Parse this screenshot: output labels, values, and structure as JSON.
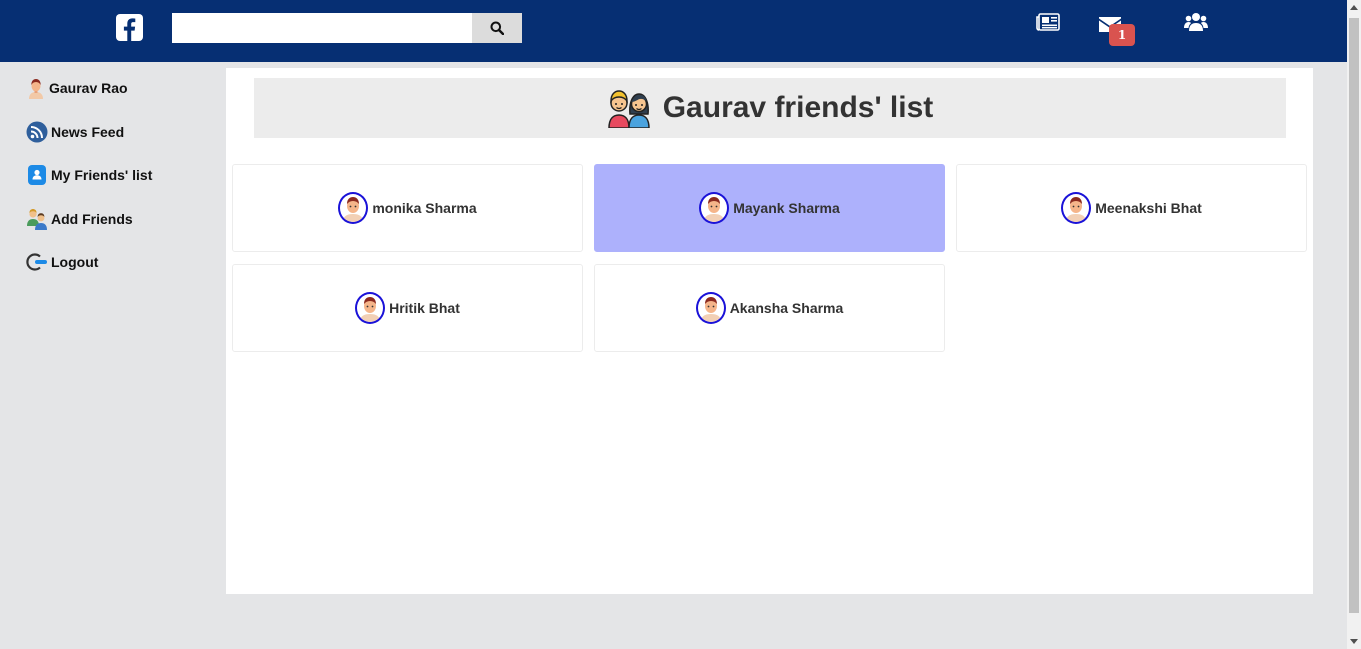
{
  "header": {
    "logo_icon": "facebook-icon",
    "search": {
      "value": "",
      "placeholder": ""
    },
    "search_button_icon": "search-icon",
    "nav_icons": [
      "newspaper-icon",
      "envelope-icon",
      "users-icon"
    ],
    "messages_badge": "1",
    "bar_color": "#062f73"
  },
  "sidebar": {
    "items": [
      {
        "label": "Gaurav Rao",
        "icon": "user-avatar-icon"
      },
      {
        "label": "News Feed",
        "icon": "rss-icon"
      },
      {
        "label": "My Friends' list",
        "icon": "contact-icon"
      },
      {
        "label": "Add Friends",
        "icon": "add-friends-icon"
      },
      {
        "label": "Logout",
        "icon": "logout-icon"
      }
    ]
  },
  "main": {
    "title": "Gaurav friends' list",
    "title_icon": "friends-couple-icon",
    "friends": [
      {
        "name": "monika Sharma",
        "active": false
      },
      {
        "name": "Mayank Sharma",
        "active": true
      },
      {
        "name": "Meenakshi Bhat",
        "active": false
      },
      {
        "name": "Hritik Bhat",
        "active": false
      },
      {
        "name": "Akansha Sharma",
        "active": false
      }
    ],
    "active_color": "#adb1fc",
    "avatar_border_color": "#1a12d8"
  }
}
